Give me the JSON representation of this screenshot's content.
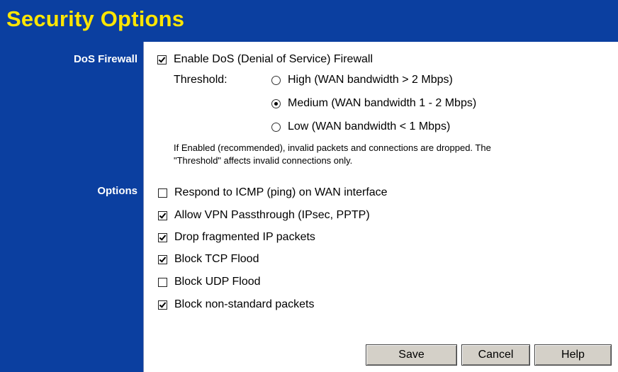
{
  "header": {
    "title": "Security Options"
  },
  "colors": {
    "header_bg": "#0b3fa0",
    "title": "#ffe600",
    "sidebar_bg": "#0b3fa0",
    "button_bg": "#d4d0c8"
  },
  "dos": {
    "section_label": "DoS Firewall",
    "enable_label": "Enable DoS (Denial of Service) Firewall",
    "enable_checked": true,
    "threshold_label": "Threshold:",
    "thresholds": [
      {
        "label": "High (WAN bandwidth > 2 Mbps)",
        "selected": false
      },
      {
        "label": "Medium (WAN bandwidth 1 - 2 Mbps)",
        "selected": true
      },
      {
        "label": "Low (WAN bandwidth < 1 Mbps)",
        "selected": false
      }
    ],
    "note_line1": "If Enabled (recommended), invalid packets and connections are dropped. The",
    "note_line2": "\"Threshold\" affects invalid connections only."
  },
  "options": {
    "section_label": "Options",
    "items": [
      {
        "label": "Respond to ICMP (ping) on WAN interface",
        "checked": false
      },
      {
        "label": "Allow VPN Passthrough (IPsec, PPTP)",
        "checked": true
      },
      {
        "label": "Drop fragmented IP packets",
        "checked": true
      },
      {
        "label": "Block TCP Flood",
        "checked": true
      },
      {
        "label": "Block UDP Flood",
        "checked": false
      },
      {
        "label": "Block non-standard packets",
        "checked": true
      }
    ]
  },
  "buttons": {
    "save": "Save",
    "cancel": "Cancel",
    "help": "Help"
  }
}
